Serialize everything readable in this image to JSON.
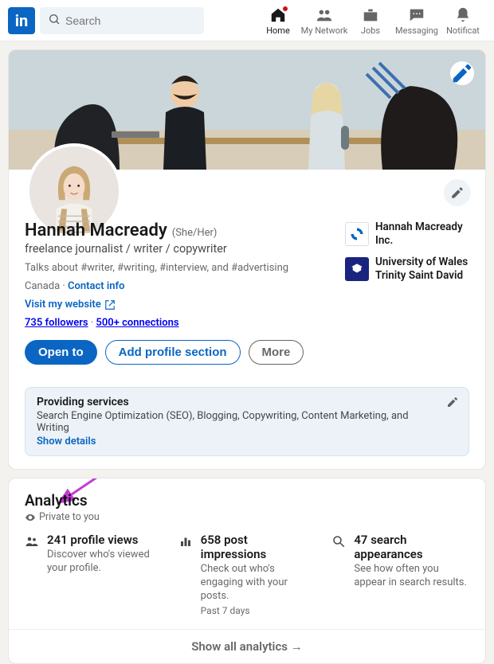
{
  "nav": {
    "search_placeholder": "Search",
    "items": [
      {
        "label": "Home",
        "active": true,
        "has_badge": true
      },
      {
        "label": "My Network"
      },
      {
        "label": "Jobs"
      },
      {
        "label": "Messaging"
      },
      {
        "label": "Notificat"
      }
    ]
  },
  "profile": {
    "name": "Hannah Macready",
    "pronouns": "(She/Her)",
    "headline": "freelance journalist / writer / copywriter",
    "talks_about": "Talks about #writer, #writing, #interview, and #advertising",
    "location": "Canada",
    "contact_label": "Contact info",
    "website_label": "Visit my website",
    "followers": "735 followers",
    "connections": "500+ connections",
    "orgs": [
      {
        "name": "Hannah Macready Inc."
      },
      {
        "name": "University of Wales Trinity Saint David"
      }
    ],
    "buttons": {
      "open_to": "Open to",
      "add_section": "Add profile section",
      "more": "More"
    },
    "services": {
      "title": "Providing services",
      "desc": "Search Engine Optimization (SEO), Blogging, Copywriting, Content Marketing, and Writing",
      "show": "Show details"
    }
  },
  "analytics": {
    "title": "Analytics",
    "private_label": "Private to you",
    "stats": [
      {
        "value": "241 profile views",
        "desc": "Discover who's viewed your profile.",
        "sub": ""
      },
      {
        "value": "658 post impressions",
        "desc": "Check out who's engaging with your posts.",
        "sub": "Past 7 days"
      },
      {
        "value": "47 search appearances",
        "desc": "See how often you appear in search results.",
        "sub": ""
      }
    ],
    "show_all": "Show all analytics →"
  }
}
